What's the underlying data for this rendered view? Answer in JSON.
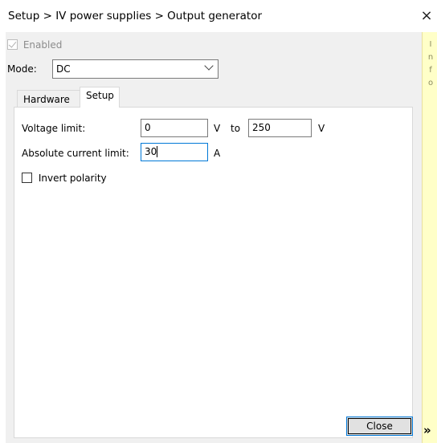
{
  "window": {
    "title": "Setup > IV power supplies > Output generator",
    "close_glyph": "×"
  },
  "enabled": {
    "label": "Enabled",
    "checked": true,
    "disabled": true
  },
  "mode": {
    "label": "Mode:",
    "value": "DC"
  },
  "tabs": [
    {
      "label": "Hardware",
      "active": false
    },
    {
      "label": "Setup",
      "active": true
    }
  ],
  "setup": {
    "voltage_limit_label": "Voltage limit:",
    "voltage_min": "0",
    "voltage_unit_1": "V",
    "to_label": "to",
    "voltage_max": "250",
    "voltage_unit_2": "V",
    "current_limit_label": "Absolute current limit:",
    "current_limit": "30",
    "current_unit": "A",
    "invert_polarity_label": "Invert polarity",
    "invert_polarity_checked": false
  },
  "buttons": {
    "close_label": "Close"
  },
  "info_panel": {
    "letters": [
      "I",
      "n",
      "f",
      "o"
    ],
    "expand_glyph": "»"
  },
  "colors": {
    "info_panel_bg": "#ffffc8",
    "focus_border": "#0078d7"
  }
}
